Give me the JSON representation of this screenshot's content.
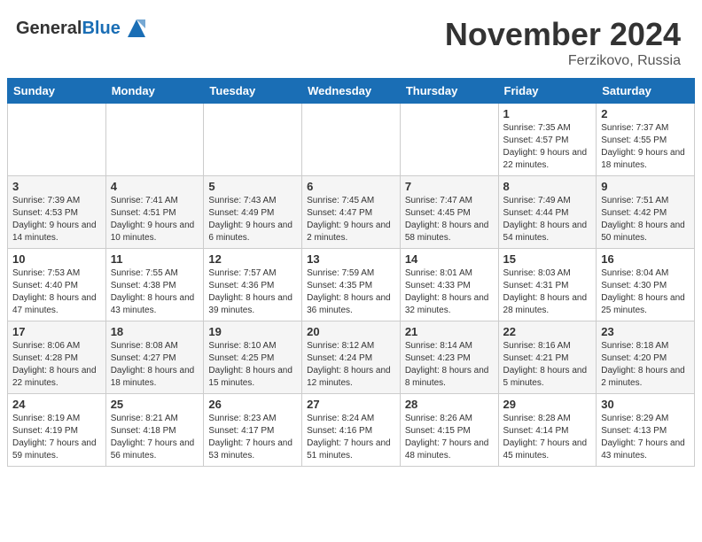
{
  "header": {
    "logo_general": "General",
    "logo_blue": "Blue",
    "month_title": "November 2024",
    "location": "Ferzikovo, Russia"
  },
  "weekdays": [
    "Sunday",
    "Monday",
    "Tuesday",
    "Wednesday",
    "Thursday",
    "Friday",
    "Saturday"
  ],
  "weeks": [
    [
      {
        "day": "",
        "detail": ""
      },
      {
        "day": "",
        "detail": ""
      },
      {
        "day": "",
        "detail": ""
      },
      {
        "day": "",
        "detail": ""
      },
      {
        "day": "",
        "detail": ""
      },
      {
        "day": "1",
        "detail": "Sunrise: 7:35 AM\nSunset: 4:57 PM\nDaylight: 9 hours and 22 minutes."
      },
      {
        "day": "2",
        "detail": "Sunrise: 7:37 AM\nSunset: 4:55 PM\nDaylight: 9 hours and 18 minutes."
      }
    ],
    [
      {
        "day": "3",
        "detail": "Sunrise: 7:39 AM\nSunset: 4:53 PM\nDaylight: 9 hours and 14 minutes."
      },
      {
        "day": "4",
        "detail": "Sunrise: 7:41 AM\nSunset: 4:51 PM\nDaylight: 9 hours and 10 minutes."
      },
      {
        "day": "5",
        "detail": "Sunrise: 7:43 AM\nSunset: 4:49 PM\nDaylight: 9 hours and 6 minutes."
      },
      {
        "day": "6",
        "detail": "Sunrise: 7:45 AM\nSunset: 4:47 PM\nDaylight: 9 hours and 2 minutes."
      },
      {
        "day": "7",
        "detail": "Sunrise: 7:47 AM\nSunset: 4:45 PM\nDaylight: 8 hours and 58 minutes."
      },
      {
        "day": "8",
        "detail": "Sunrise: 7:49 AM\nSunset: 4:44 PM\nDaylight: 8 hours and 54 minutes."
      },
      {
        "day": "9",
        "detail": "Sunrise: 7:51 AM\nSunset: 4:42 PM\nDaylight: 8 hours and 50 minutes."
      }
    ],
    [
      {
        "day": "10",
        "detail": "Sunrise: 7:53 AM\nSunset: 4:40 PM\nDaylight: 8 hours and 47 minutes."
      },
      {
        "day": "11",
        "detail": "Sunrise: 7:55 AM\nSunset: 4:38 PM\nDaylight: 8 hours and 43 minutes."
      },
      {
        "day": "12",
        "detail": "Sunrise: 7:57 AM\nSunset: 4:36 PM\nDaylight: 8 hours and 39 minutes."
      },
      {
        "day": "13",
        "detail": "Sunrise: 7:59 AM\nSunset: 4:35 PM\nDaylight: 8 hours and 36 minutes."
      },
      {
        "day": "14",
        "detail": "Sunrise: 8:01 AM\nSunset: 4:33 PM\nDaylight: 8 hours and 32 minutes."
      },
      {
        "day": "15",
        "detail": "Sunrise: 8:03 AM\nSunset: 4:31 PM\nDaylight: 8 hours and 28 minutes."
      },
      {
        "day": "16",
        "detail": "Sunrise: 8:04 AM\nSunset: 4:30 PM\nDaylight: 8 hours and 25 minutes."
      }
    ],
    [
      {
        "day": "17",
        "detail": "Sunrise: 8:06 AM\nSunset: 4:28 PM\nDaylight: 8 hours and 22 minutes."
      },
      {
        "day": "18",
        "detail": "Sunrise: 8:08 AM\nSunset: 4:27 PM\nDaylight: 8 hours and 18 minutes."
      },
      {
        "day": "19",
        "detail": "Sunrise: 8:10 AM\nSunset: 4:25 PM\nDaylight: 8 hours and 15 minutes."
      },
      {
        "day": "20",
        "detail": "Sunrise: 8:12 AM\nSunset: 4:24 PM\nDaylight: 8 hours and 12 minutes."
      },
      {
        "day": "21",
        "detail": "Sunrise: 8:14 AM\nSunset: 4:23 PM\nDaylight: 8 hours and 8 minutes."
      },
      {
        "day": "22",
        "detail": "Sunrise: 8:16 AM\nSunset: 4:21 PM\nDaylight: 8 hours and 5 minutes."
      },
      {
        "day": "23",
        "detail": "Sunrise: 8:18 AM\nSunset: 4:20 PM\nDaylight: 8 hours and 2 minutes."
      }
    ],
    [
      {
        "day": "24",
        "detail": "Sunrise: 8:19 AM\nSunset: 4:19 PM\nDaylight: 7 hours and 59 minutes."
      },
      {
        "day": "25",
        "detail": "Sunrise: 8:21 AM\nSunset: 4:18 PM\nDaylight: 7 hours and 56 minutes."
      },
      {
        "day": "26",
        "detail": "Sunrise: 8:23 AM\nSunset: 4:17 PM\nDaylight: 7 hours and 53 minutes."
      },
      {
        "day": "27",
        "detail": "Sunrise: 8:24 AM\nSunset: 4:16 PM\nDaylight: 7 hours and 51 minutes."
      },
      {
        "day": "28",
        "detail": "Sunrise: 8:26 AM\nSunset: 4:15 PM\nDaylight: 7 hours and 48 minutes."
      },
      {
        "day": "29",
        "detail": "Sunrise: 8:28 AM\nSunset: 4:14 PM\nDaylight: 7 hours and 45 minutes."
      },
      {
        "day": "30",
        "detail": "Sunrise: 8:29 AM\nSunset: 4:13 PM\nDaylight: 7 hours and 43 minutes."
      }
    ]
  ]
}
